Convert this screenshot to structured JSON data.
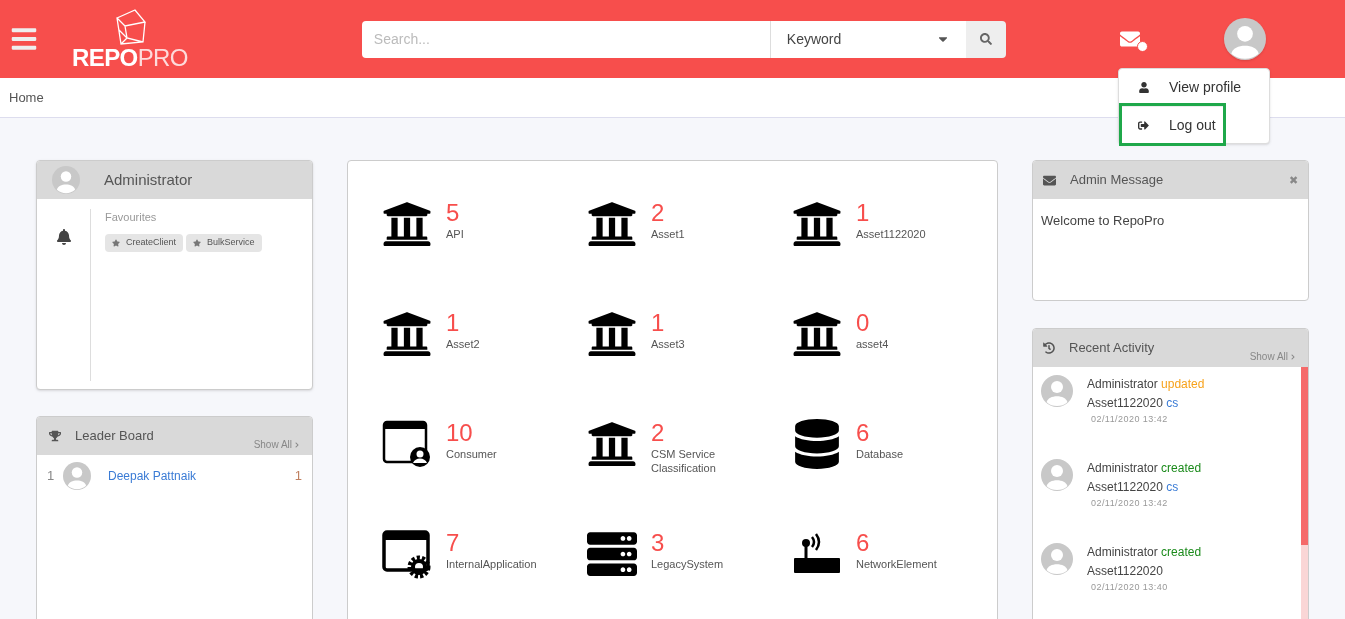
{
  "header": {
    "logo": {
      "bold": "REPO",
      "light": "PRO"
    },
    "search": {
      "placeholder": "Search...",
      "filter": "Keyword"
    },
    "user_menu": [
      {
        "label": "View profile",
        "kind": "profile",
        "highlighted": false
      },
      {
        "label": "Log out",
        "kind": "logout",
        "highlighted": true
      }
    ]
  },
  "breadcrumb": "Home",
  "profile_card": {
    "name": "Administrator",
    "favourites_title": "Favourites",
    "favourites": [
      "CreateClient",
      "BulkService"
    ]
  },
  "leader_board": {
    "title": "Leader Board",
    "show_all": "Show All",
    "rows": [
      {
        "rank": "1",
        "name": "Deepak Pattnaik",
        "score": "1"
      }
    ]
  },
  "asset_types": [
    {
      "count": "5",
      "name": "API",
      "kind": "building"
    },
    {
      "count": "2",
      "name": "Asset1",
      "kind": "building"
    },
    {
      "count": "1",
      "name": "Asset1122020",
      "kind": "building"
    },
    {
      "count": "1",
      "name": "Asset2",
      "kind": "building"
    },
    {
      "count": "1",
      "name": "Asset3",
      "kind": "building"
    },
    {
      "count": "0",
      "name": "asset4",
      "kind": "building"
    },
    {
      "count": "10",
      "name": "Consumer",
      "kind": "window-user"
    },
    {
      "count": "2",
      "name": "CSM Service Classification",
      "kind": "building"
    },
    {
      "count": "6",
      "name": "Database",
      "kind": "database"
    },
    {
      "count": "7",
      "name": "InternalApplication",
      "kind": "window-gear"
    },
    {
      "count": "3",
      "name": "LegacySystem",
      "kind": "server"
    },
    {
      "count": "6",
      "name": "NetworkElement",
      "kind": "router"
    }
  ],
  "admin_message": {
    "title": "Admin Message",
    "close": "✖",
    "body": "Welcome to RepoPro"
  },
  "recent_activity": {
    "title": "Recent Activity",
    "show_all": "Show All",
    "items": [
      {
        "user": "Administrator",
        "action": "updated",
        "kind": "updated",
        "asset": "Asset1122020",
        "version": "cs",
        "time": "02/11/2020 13:42"
      },
      {
        "user": "Administrator",
        "action": "created",
        "kind": "created",
        "asset": "Asset1122020",
        "version": "cs",
        "time": "02/11/2020 13:42"
      },
      {
        "user": "Administrator",
        "action": "created",
        "kind": "created",
        "asset": "Asset1122020",
        "time": "02/11/2020 13:40"
      }
    ]
  }
}
